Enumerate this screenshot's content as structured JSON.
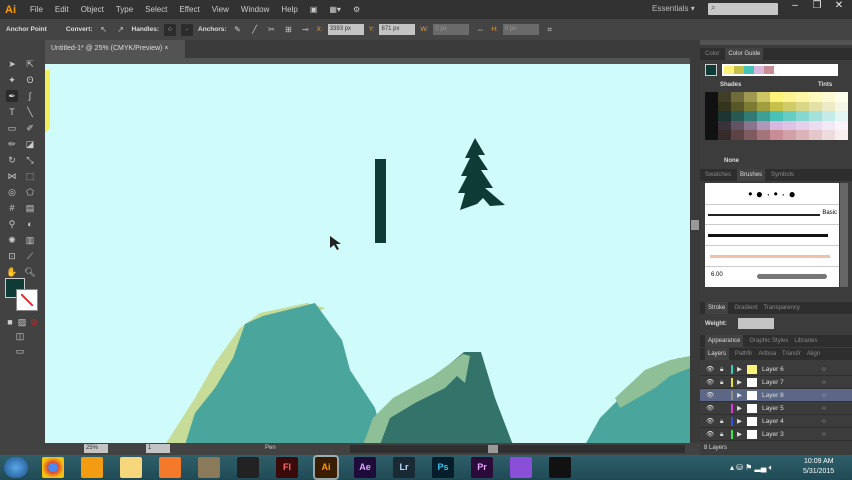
{
  "app": {
    "logo": "Ai",
    "menu": [
      "File",
      "Edit",
      "Object",
      "Type",
      "Select",
      "Effect",
      "View",
      "Window",
      "Help"
    ],
    "workspace": "Essentials",
    "search_placeholder": ""
  },
  "control": {
    "tool": "Anchor Point",
    "convert": "Convert:",
    "handles": "Handles:",
    "anchors": "Anchors:",
    "x": "3393 px",
    "y": "871 px",
    "w": "0 px",
    "h": "0 px"
  },
  "document": {
    "tab": "Untitled-1* @ 25% (CMYK/Preview)",
    "zoom": "25%",
    "artboard": "1",
    "status_tool": "Pen"
  },
  "colors": {
    "canvas": "#cffcfb",
    "mountain": "#4aa59c",
    "mountain_light": "#c6dc98",
    "mountain_dark": "#33736a",
    "ink": "#0e3b36",
    "fill": "#0e3b36"
  },
  "color_panel": {
    "tabs": [
      "Color",
      "Color Guide"
    ],
    "shades": "Shades",
    "tints": "Tints",
    "none": "None",
    "harmony": [
      "#fdf27a",
      "#c5c14a",
      "#48c2b7",
      "#d8b7e0",
      "#c98d95"
    ]
  },
  "brushes": {
    "tabs": [
      "Swatches",
      "Brushes",
      "Symbols"
    ],
    "basic": "Basic",
    "size": "6.00"
  },
  "stroke": {
    "tabs": [
      "Stroke",
      "Gradient",
      "Transparency"
    ],
    "weight_label": "Weight:",
    "weight": ""
  },
  "appearance": {
    "tabs": [
      "Appearance",
      "Graphic Styles",
      "Libraries"
    ]
  },
  "layers": {
    "tabs": [
      "Layers",
      "Pathfir",
      "Artboa",
      "Transfr",
      "Align"
    ],
    "items": [
      {
        "name": "Layer 6",
        "color": "#2ad1c0",
        "locked": true,
        "selected": false
      },
      {
        "name": "Layer 7",
        "color": "#e6e23a",
        "locked": true,
        "selected": false
      },
      {
        "name": "Layer 8",
        "color": "#8d8d8d",
        "locked": false,
        "selected": true
      },
      {
        "name": "Layer 5",
        "color": "#d43ad6",
        "locked": false,
        "selected": false
      },
      {
        "name": "Layer 4",
        "color": "#3a4fe6",
        "locked": true,
        "selected": false
      },
      {
        "name": "Layer 3",
        "color": "#3ae64f",
        "locked": true,
        "selected": false
      }
    ],
    "count": "8 Layers"
  },
  "taskbar": {
    "apps": [
      {
        "id": "chrome",
        "label": ""
      },
      {
        "id": "media",
        "label": ""
      },
      {
        "id": "explorer",
        "label": ""
      },
      {
        "id": "blender",
        "label": ""
      },
      {
        "id": "gimp",
        "label": ""
      },
      {
        "id": "video",
        "label": ""
      },
      {
        "id": "flash",
        "label": "Fl"
      },
      {
        "id": "illustrator",
        "label": "Ai"
      },
      {
        "id": "aftereffects",
        "label": "Ae"
      },
      {
        "id": "lightroom",
        "label": "Lr"
      },
      {
        "id": "photoshop",
        "label": "Ps"
      },
      {
        "id": "premiere",
        "label": "Pr"
      },
      {
        "id": "bittorrent",
        "label": ""
      },
      {
        "id": "obs",
        "label": ""
      }
    ],
    "time": "10:09 AM",
    "date": "5/31/2015"
  }
}
